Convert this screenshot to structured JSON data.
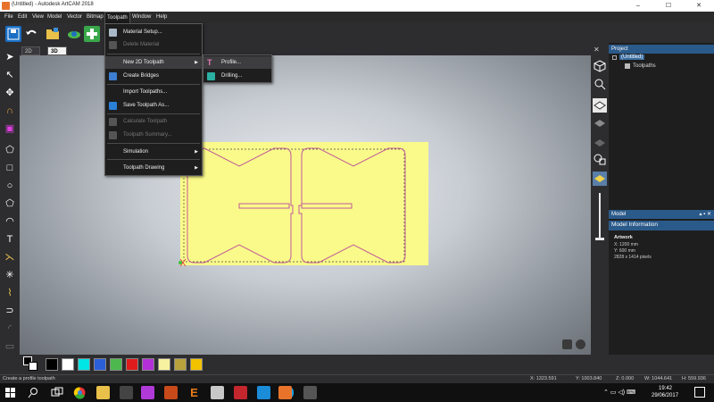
{
  "window": {
    "title": "(Untitled) - Autodesk ArtCAM 2018",
    "controls": [
      "–",
      "☐",
      "✕"
    ]
  },
  "menubar": [
    "File",
    "Edit",
    "View",
    "Model",
    "Vector",
    "Bitmap",
    "Toolpath",
    "Window",
    "Help"
  ],
  "active_menu": "Toolpath",
  "view_tabs": [
    {
      "label": "2D View",
      "active": false
    },
    {
      "label": "3D View",
      "active": true
    }
  ],
  "toolpath_menu": [
    {
      "label": "Material Setup...",
      "enabled": true,
      "icon": "material-setup-icon"
    },
    {
      "label": "Delete Material",
      "enabled": false,
      "icon": "delete-material-icon"
    },
    {
      "label": "New 2D Toolpath",
      "enabled": true,
      "submenu": true,
      "highlight": true
    },
    {
      "label": "Create Bridges",
      "enabled": true,
      "icon": "bridges-icon"
    },
    {
      "label": "Import Toolpaths...",
      "enabled": true
    },
    {
      "label": "Save Toolpath As...",
      "enabled": true,
      "icon": "save-toolpath-icon"
    },
    {
      "label": "Calculate Toolpath",
      "enabled": false,
      "icon": "calculate-icon"
    },
    {
      "label": "Toolpath Summary...",
      "enabled": false,
      "icon": "summary-icon"
    },
    {
      "label": "Simulation",
      "enabled": true,
      "submenu": true
    },
    {
      "label": "Toolpath Drawing",
      "enabled": true,
      "submenu": true
    }
  ],
  "submenu_2d": [
    {
      "label": "Profile...",
      "icon": "profile-icon",
      "highlight": true
    },
    {
      "label": "Drilling...",
      "icon": "drilling-icon"
    }
  ],
  "project_panel": {
    "header": "Project",
    "root": "(Untitled)",
    "child": "Toolpaths"
  },
  "model_panel": {
    "header": "Model",
    "info_header": "Model Information",
    "section": "Artwork",
    "lines": [
      "X: 1200 mm",
      "Y: 600 mm",
      "2828 x 1414 pixels"
    ]
  },
  "palette": {
    "colors": [
      "#000000",
      "#ffffff",
      "#00e5e5",
      "#2b5fd9",
      "#4db84d",
      "#e01b1b",
      "#b32fd6",
      "#f7f2a0",
      "#b8a23c",
      "#f2c200"
    ]
  },
  "status": {
    "message": "Create a profile toolpath",
    "x": "X: 1323.591",
    "y": "Y: 1003.840",
    "z": "Z: 0.000",
    "w": "W: 1044.641",
    "h": "H: 559.936"
  },
  "taskbar": {
    "time": "19:42",
    "date": "29/06/2017"
  }
}
